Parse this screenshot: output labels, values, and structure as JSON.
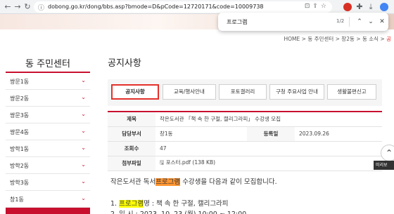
{
  "browser": {
    "url": "dobong.go.kr/dong/bbs.asp?bmode=D&pCode=12720171&code=10009738",
    "find_query": "프로그램",
    "find_count": "1/2"
  },
  "breadcrumb": {
    "home": "HOME",
    "items": [
      "동 주민센터",
      "창2동",
      "동 소식"
    ],
    "current": "공"
  },
  "sidebar": {
    "title": "동 주민센터",
    "items": [
      {
        "label": "쌍문1동"
      },
      {
        "label": "쌍문2동"
      },
      {
        "label": "쌍문3동"
      },
      {
        "label": "쌍문4동"
      },
      {
        "label": "방학1동"
      },
      {
        "label": "방학2동"
      },
      {
        "label": "방학3동"
      },
      {
        "label": "창1동"
      }
    ]
  },
  "main": {
    "title": "공지사항",
    "tabs": [
      {
        "label": "공지사항",
        "active": true
      },
      {
        "label": "교육/행사안내",
        "active": false
      },
      {
        "label": "포토갤러리",
        "active": false
      },
      {
        "label": "구청 주요사업 안내",
        "active": false
      },
      {
        "label": "생활불편신고",
        "active": false
      }
    ],
    "info": {
      "subject_label": "제목",
      "subject_value": "작은도서관 「책 속 한 구절, 캘리그라피」 수강생 모집",
      "dept_label": "담당부서",
      "dept_value": "창1동",
      "date_label": "등록일",
      "date_value": "2023.09.26",
      "views_label": "조회수",
      "views_value": "47",
      "attach_label": "첨부파일",
      "attach_value": "포스터.pdf (138 KB)"
    },
    "body": {
      "line1_pre": "작은도서관 독서",
      "line1_hl": "프로그램",
      "line1_post": " 수강생을 다음과 같이 모집합니다.",
      "line2_pre": "1. ",
      "line2_hl": "프로그램",
      "line2_post": "명 : 책 속 한 구절, 캘리그라피",
      "line3": "2. 일 시 : 2023. 10. 23.(월) 10:00 ~ 12:00"
    },
    "side_tag": "미리보"
  },
  "colors": {
    "accent_red": "#c8102e",
    "highlight_orange": "#ff9632",
    "highlight_yellow": "#ffff00"
  }
}
